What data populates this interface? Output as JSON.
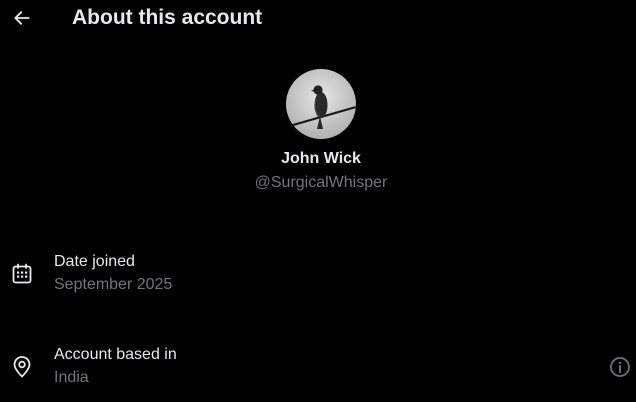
{
  "header": {
    "title": "About this account",
    "back_icon": "arrow-left-icon"
  },
  "profile": {
    "display_name": "John Wick",
    "handle": "@SurgicalWhisper",
    "avatar": "bird-on-wire-avatar"
  },
  "rows": [
    {
      "icon": "calendar-icon",
      "label": "Date joined",
      "value": "September 2025"
    },
    {
      "icon": "location-pin-icon",
      "label": "Account based in",
      "value": "India"
    }
  ],
  "info_icon": "info-circle-icon",
  "colors": {
    "background": "#000000",
    "primary_text": "#e7e9ea",
    "secondary_text": "#71767b"
  }
}
